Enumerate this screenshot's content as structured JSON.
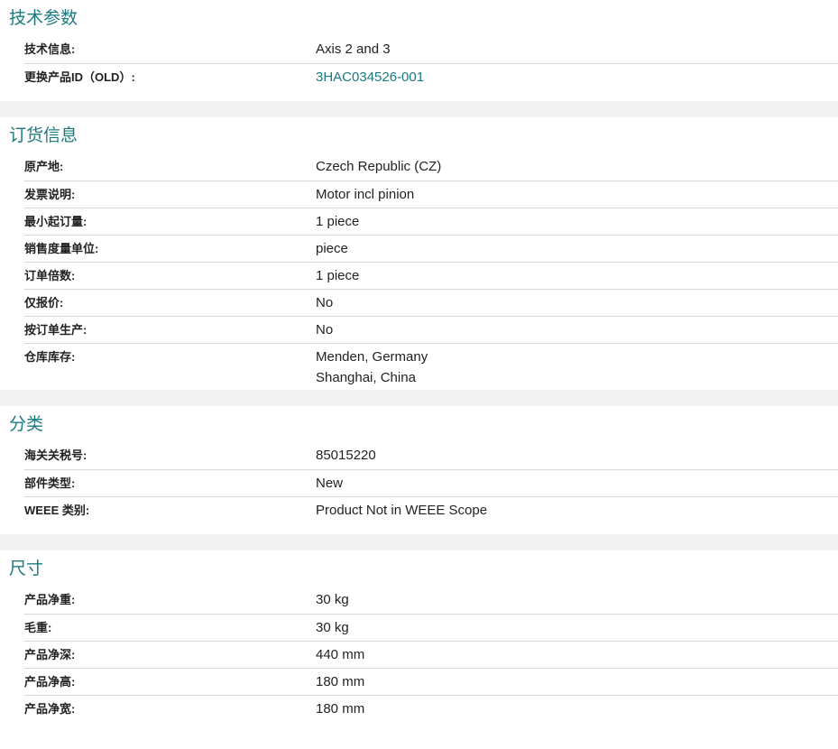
{
  "sections": [
    {
      "title": "技术参数",
      "rows": [
        {
          "label": "技术信息:",
          "value": "Axis 2 and 3"
        },
        {
          "label": "更换产品ID（OLD）:",
          "value": "3HAC034526-001"
        }
      ]
    },
    {
      "title": "订货信息",
      "rows": [
        {
          "label": "原产地:",
          "value": "Czech Republic (CZ)"
        },
        {
          "label": "发票说明:",
          "value": "Motor incl pinion"
        },
        {
          "label": "最小起订量:",
          "value": "1 piece"
        },
        {
          "label": "销售度量单位:",
          "value": "piece"
        },
        {
          "label": "订单倍数:",
          "value": "1 piece"
        },
        {
          "label": "仅报价:",
          "value": "No"
        },
        {
          "label": "按订单生产:",
          "value": "No"
        },
        {
          "label": "仓库库存:",
          "value": "Menden, Germany",
          "value2": "Shanghai, China"
        }
      ]
    },
    {
      "title": "分类",
      "rows": [
        {
          "label": "海关关税号:",
          "value": "85015220"
        },
        {
          "label": "部件类型:",
          "value": "New"
        },
        {
          "label": "WEEE 类别:",
          "value": "Product Not in WEEE Scope"
        }
      ]
    },
    {
      "title": "尺寸",
      "rows": [
        {
          "label": "产品净重:",
          "value": "30 kg"
        },
        {
          "label": "毛重:",
          "value": "30 kg"
        },
        {
          "label": "产品净深:",
          "value": "440 mm"
        },
        {
          "label": "产品净高:",
          "value": "180 mm"
        },
        {
          "label": "产品净宽:",
          "value": "180 mm"
        }
      ]
    }
  ],
  "colors": {
    "accent": "#1c7a7e",
    "divider": "#d7d7d7",
    "gap": "#f2f2f2"
  }
}
